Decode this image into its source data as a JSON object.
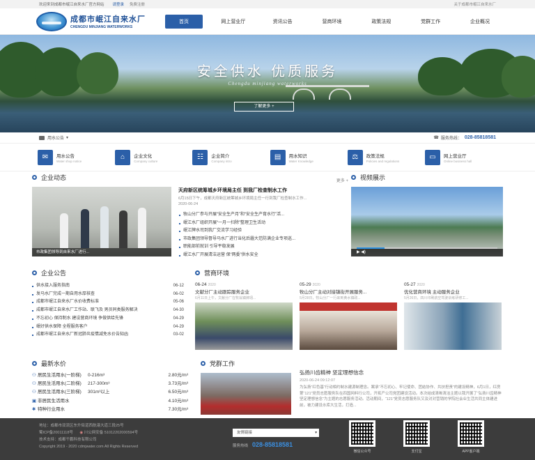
{
  "topbar": {
    "welcome": "欢迎来到成都市岷江自来水厂官方网站",
    "link_1": "请登录",
    "link_2": "免费注册",
    "about": "关于成都市岷江自来水厂"
  },
  "header": {
    "logo_cn": "成都市岷江自来水厂",
    "logo_en": "CHENGDU MINJIANG WATERWORKS",
    "nav": [
      "首页",
      "网上营业厅",
      "资讯公告",
      "营商环境",
      "政策法规",
      "党群工作",
      "企业概况"
    ],
    "active_nav": "首页"
  },
  "banner": {
    "slogan": "安全供水 优质服务",
    "slogan_en": "Chengdu minjiang waterworks",
    "button": "了解更多 +"
  },
  "notice_bar": {
    "label": "用水公告",
    "hotline_label": "服务热线：",
    "hotline": "028-85818581"
  },
  "quick_links": [
    {
      "title": "用水公告",
      "sub": "Water shop notice",
      "icon": "megaphone-icon"
    },
    {
      "title": "企业文化",
      "sub": "Company culture",
      "icon": "building-icon"
    },
    {
      "title": "企业简介",
      "sub": "Company intro",
      "icon": "org-icon"
    },
    {
      "title": "用水知识",
      "sub": "Water Knowledge",
      "icon": "book-icon"
    },
    {
      "title": "政策法规",
      "sub": "Policies and regulations",
      "icon": "gavel-icon"
    },
    {
      "title": "网上营业厅",
      "sub": "Online business hall",
      "icon": "monitor-icon"
    }
  ],
  "company_news": {
    "title": "企业动态",
    "more": "更多 +",
    "photo_caption": "市政集团领导到自来水厂进行...",
    "top_title": "天府新区统筹城乡环境局主任 到我厂检查制水工作",
    "top_summary": "6月15日下午，成都天府新区统筹城乡环境局主任一行到我厂检查制水工作...",
    "top_date": "2020-06-24",
    "items": [
      "牧山分厂参与开展“安全生产月”和“安全生产育水行”活...",
      "岷江水厂组织开展“一月一扫除”整理卫生活动",
      "岷江牌水司到我厂交流学习经验",
      "市政集团领导督导马水厂进行当化后霾大范防满企业专项巡...",
      "职能部前就训 引导平稳发展",
      "岷江水厂开展清洁运营 保“两委”供水安全"
    ]
  },
  "video": {
    "title": "视频展示"
  },
  "notices": {
    "title": "企业公告",
    "items": [
      {
        "text": "供水接入服务指南",
        "date": "06-12"
      },
      {
        "text": "发马水厂完成一期自用水厚核查",
        "date": "06-02"
      },
      {
        "text": "成都市岷江自来水厂水价收费标准",
        "date": "05-06"
      },
      {
        "text": "成都市岷江自来水厂工作站、联飞及 男员同类服务解决",
        "date": "04-30"
      },
      {
        "text": "不忘初心 保持制水 建设营商环境 争做供给先锋",
        "date": "04-29"
      },
      {
        "text": "岷好供水保障 全程服务客户",
        "date": "04-29"
      },
      {
        "text": "成都市岷江自来水厂新冠肺炎疫情减免水价告知函",
        "date": "03-02"
      }
    ]
  },
  "business": {
    "title": "营商环境",
    "cards": [
      {
        "date": "06-24",
        "year": "2020",
        "title": "文献分厂主动跟踪服务企业",
        "sub": "6月11日上午，文献分厂在牧翁镇牌翊..."
      },
      {
        "date": "05-29",
        "year": "2020",
        "title": "牧山分厂主动对接镇街开展服务...",
        "sub": "5月28日，牧山分厂一行来到黄水镇政..."
      },
      {
        "date": "05-27",
        "year": "2020",
        "title": "优化营商环境 主动服务企业",
        "sub": "5月26日，四川印刷航空驾驶训练研修工..."
      }
    ]
  },
  "prices": {
    "title": "最新水价",
    "rows": [
      {
        "name": "居民生活用水(一阶梯)",
        "range": "0-216m³",
        "price": "2.80元/m³"
      },
      {
        "name": "居民生活用水(二阶梯)",
        "range": "217-300m³",
        "price": "3.73元/m³"
      },
      {
        "name": "居民生活用水(三阶梯)",
        "range": "301m³以上",
        "price": "6.50元/m³"
      },
      {
        "name": "非居民生活用水",
        "range": "",
        "price": "4.10元/m³"
      },
      {
        "name": "特种行业用水",
        "range": "",
        "price": "7.30元/m³"
      }
    ]
  },
  "party": {
    "title": "党群工作",
    "news_title": "弘扬川齿精神 坚定理想信念",
    "news_date": "2020-06-24 09:12:07",
    "news_summary": "为弘扬“红色基”行动相约制水建源制理念。案承“不忘初心、牢记使命、团结协作、共扶担责”的建设精神，6月1日，红房第“121”党员志愿服务队在四国网料行公司，开拓产公司党团建设活动。本次结成清晰清洁主题以我开展了“弘扬川齿精神坚定理想信念”为主题的志愿服务活动。活动期间，“121”党员志愿服务队又及对对营销的学院社会业生活共同主体建进前，被力建设水库大生活，打造..."
  },
  "footer": {
    "address": "地址：成都市双流区东升街道西航港大道三段25号",
    "icp": "蜀ICP备20011118号",
    "police": "川公网安备 51012202000594号",
    "support": "技术支持：成都千鹏科技有限公司",
    "copyright": "Copyright 2019 - 2020 cdmjwater.com All Rights Reserved",
    "select": "友情链接",
    "hot_label": "服务热线",
    "hot_phone": "028-85818581",
    "qr": [
      "微信公众号",
      "支付宝",
      "APP客户端"
    ]
  }
}
